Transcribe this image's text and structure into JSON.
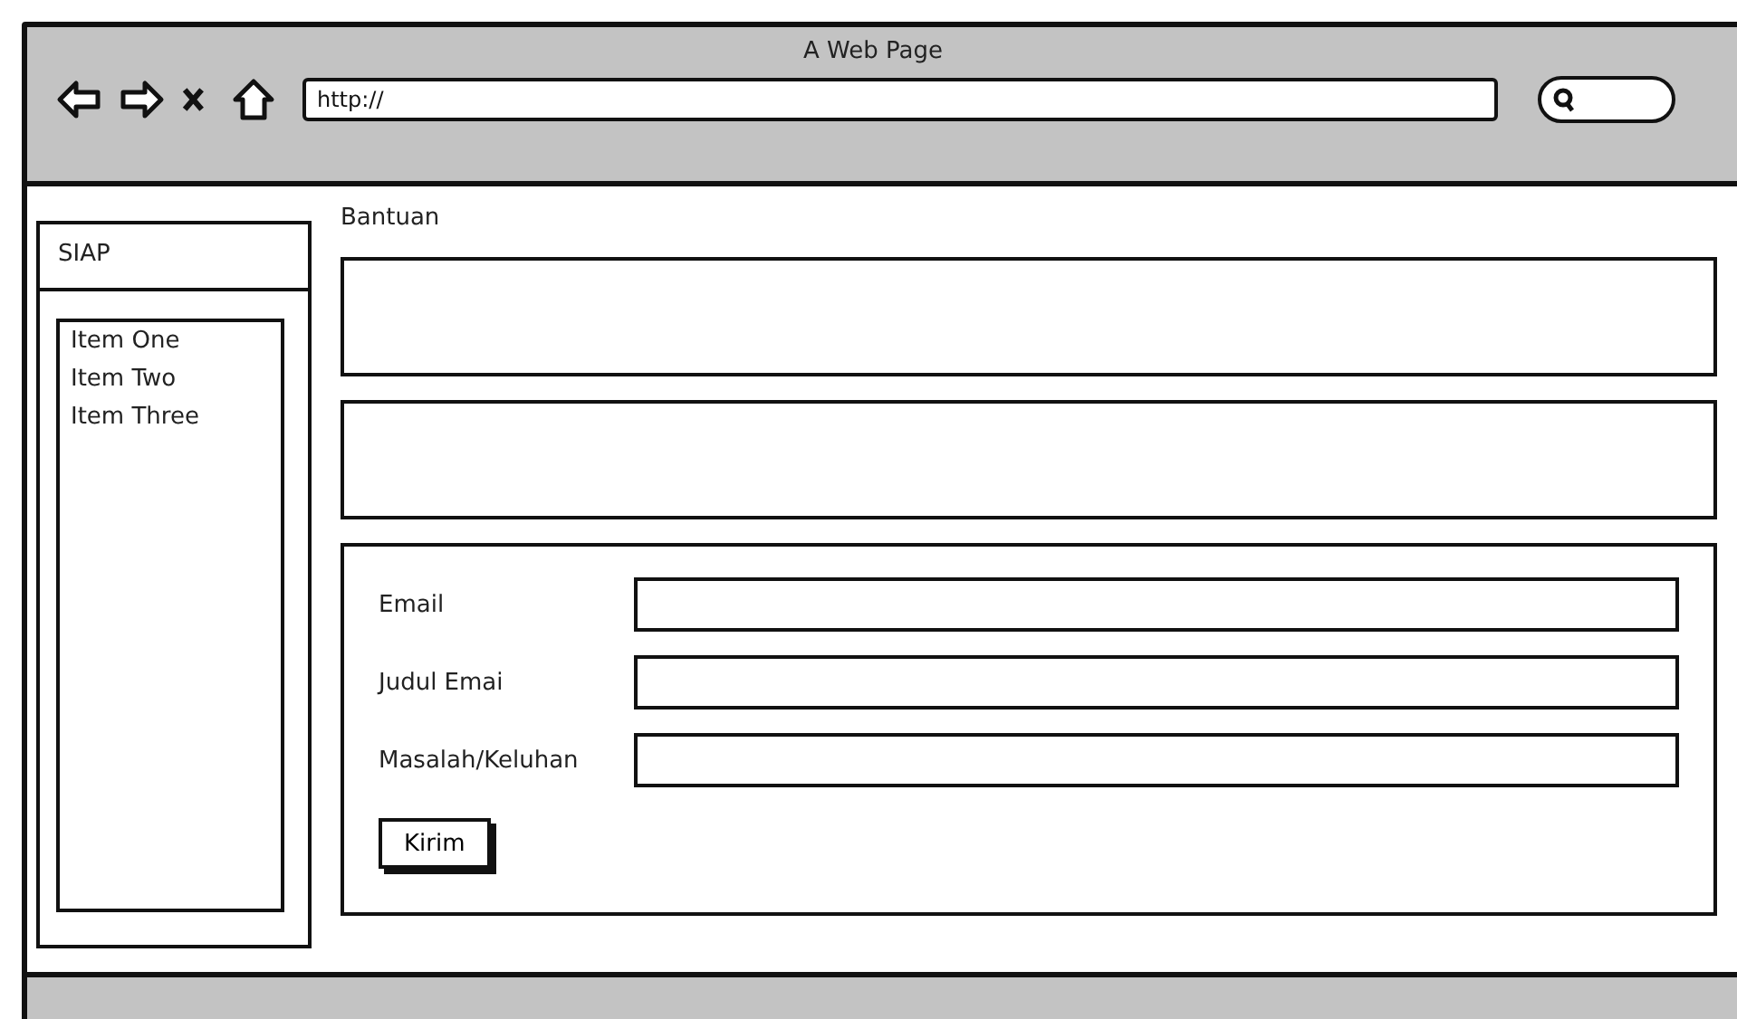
{
  "window": {
    "title": "A Web Page"
  },
  "address_bar": {
    "value": "http://"
  },
  "sidebar": {
    "title": "SIAP",
    "items": [
      {
        "label": "Item One"
      },
      {
        "label": "Item Two"
      },
      {
        "label": "Item Three"
      }
    ]
  },
  "main": {
    "heading": "Bantuan",
    "form": {
      "fields": [
        {
          "label": "Email"
        },
        {
          "label": "Judul Emai"
        },
        {
          "label": "Masalah/Keluhan"
        }
      ],
      "submit": "Kirim"
    }
  }
}
